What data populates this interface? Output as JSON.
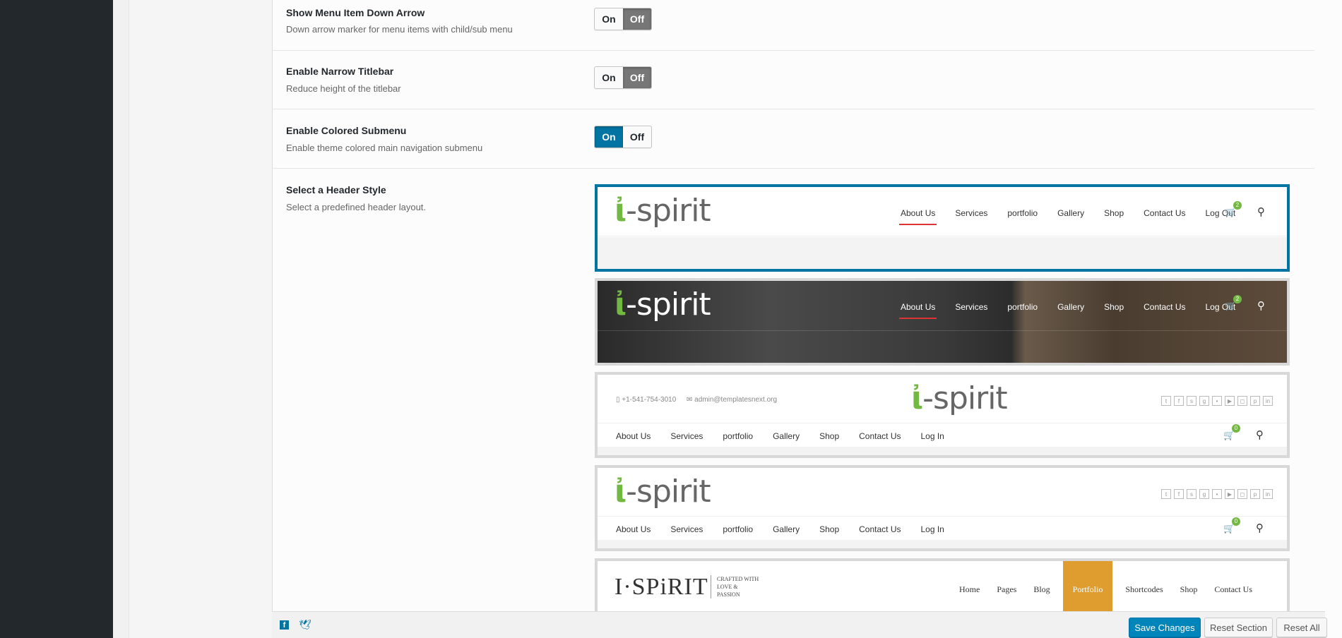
{
  "fields": [
    {
      "title": "Show Menu Item Down Arrow",
      "desc": "Down arrow marker for menu items with child/sub menu",
      "on": "On",
      "off": "Off",
      "value": "off"
    },
    {
      "title": "Enable Narrow Titlebar",
      "desc": "Reduce height of the titlebar",
      "on": "On",
      "off": "Off",
      "value": "off"
    },
    {
      "title": "Enable Colored Submenu",
      "desc": "Enable theme colored main navigation submenu",
      "on": "On",
      "off": "Off",
      "value": "on"
    }
  ],
  "header_style": {
    "title": "Select a Header Style",
    "desc": "Select a predefined header layout.",
    "selected_index": 0,
    "logo_text": "-spirit",
    "options": [
      {
        "nav": [
          "About Us",
          "Services",
          "portfolio",
          "Gallery",
          "Shop",
          "Contact Us",
          "Log Out"
        ],
        "cart_count": "2"
      },
      {
        "nav": [
          "About Us",
          "Services",
          "portfolio",
          "Gallery",
          "Shop",
          "Contact Us",
          "Log Out"
        ],
        "cart_count": "2"
      },
      {
        "phone": "+1-541-754-3010",
        "email": "admin@templatesnext.org",
        "nav": [
          "About Us",
          "Services",
          "portfolio",
          "Gallery",
          "Shop",
          "Contact Us",
          "Log In"
        ],
        "cart_count": "0"
      },
      {
        "nav": [
          "About Us",
          "Services",
          "portfolio",
          "Gallery",
          "Shop",
          "Contact Us",
          "Log In"
        ],
        "cart_count": "0"
      },
      {
        "logo": "I·SPiRIT",
        "tagline": [
          "CRAFTED WITH",
          "LOVE &",
          "PASSION"
        ],
        "nav": [
          "Home",
          "Pages",
          "Blog",
          "Portfolio",
          "Shortcodes",
          "Shop",
          "Contact Us"
        ],
        "active": "Portfolio"
      }
    ]
  },
  "footer": {
    "save": "Save Changes",
    "reset_section": "Reset Section",
    "reset_all": "Reset All"
  },
  "colors": {
    "accent": "#0074a2",
    "green": "#73b843",
    "orange": "#e09d2f"
  }
}
